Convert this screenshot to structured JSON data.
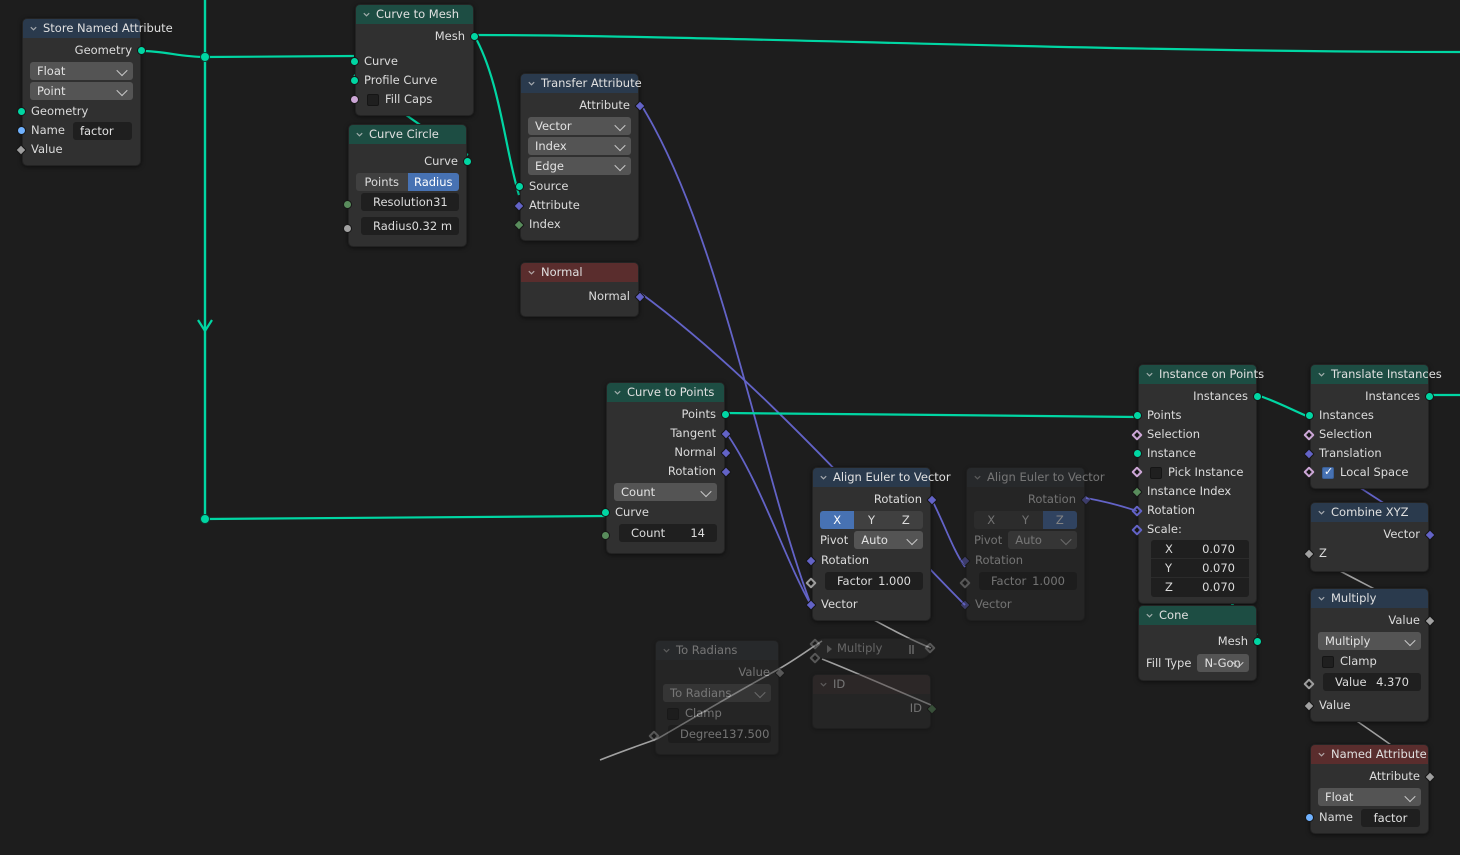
{
  "editor": {
    "name": "Geometry Node Editor",
    "background": "#1d1d1d"
  },
  "colors": {
    "header_geometry": "#1d4d43",
    "header_input": "#2a3a4d",
    "header_attribute": "#5a2d2d",
    "wire_geometry": "#00d6a3",
    "wire_vector": "#6363c7",
    "wire_value": "#a1a1a1",
    "accent_selected": "#4772b3"
  },
  "nodes": {
    "store_named_attribute": {
      "title": "Store Named Attribute",
      "data_type": "Float",
      "domain": "Point",
      "outputs": [
        {
          "label": "Geometry"
        }
      ],
      "inputs": [
        {
          "label": "Geometry"
        },
        {
          "label": "Name",
          "value": "factor"
        },
        {
          "label": "Value"
        }
      ]
    },
    "curve_to_mesh": {
      "title": "Curve to Mesh",
      "outputs": [
        {
          "label": "Mesh"
        }
      ],
      "inputs": [
        {
          "label": "Curve"
        },
        {
          "label": "Profile Curve"
        },
        {
          "label": "Fill Caps",
          "checked": false
        }
      ]
    },
    "curve_circle": {
      "title": "Curve Circle",
      "outputs": [
        {
          "label": "Curve"
        }
      ],
      "mode_options": [
        "Points",
        "Radius"
      ],
      "mode_selected": "Radius",
      "fields": [
        {
          "label": "Resolution",
          "value": "31"
        },
        {
          "label": "Radius",
          "value": "0.32 m"
        }
      ]
    },
    "transfer_attribute": {
      "title": "Transfer Attribute",
      "outputs": [
        {
          "label": "Attribute"
        }
      ],
      "data_type": "Vector",
      "mapping": "Index",
      "domain": "Edge",
      "inputs": [
        {
          "label": "Source"
        },
        {
          "label": "Attribute"
        },
        {
          "label": "Index"
        }
      ]
    },
    "normal": {
      "title": "Normal",
      "outputs": [
        {
          "label": "Normal"
        }
      ]
    },
    "curve_to_points": {
      "title": "Curve to Points",
      "outputs": [
        {
          "label": "Points"
        },
        {
          "label": "Tangent"
        },
        {
          "label": "Normal"
        },
        {
          "label": "Rotation"
        }
      ],
      "mode": "Count",
      "inputs": [
        {
          "label": "Curve"
        }
      ],
      "fields": [
        {
          "label": "Count",
          "value": "14"
        }
      ]
    },
    "align_euler_1": {
      "title": "Align Euler to Vector",
      "muted": false,
      "outputs": [
        {
          "label": "Rotation"
        }
      ],
      "axis_options": [
        "X",
        "Y",
        "Z"
      ],
      "axis_selected": "X",
      "pivot_label": "Pivot",
      "pivot_value": "Auto",
      "inputs": [
        {
          "label": "Rotation"
        },
        {
          "label": "Factor",
          "value": "1.000"
        },
        {
          "label": "Vector"
        }
      ]
    },
    "align_euler_2": {
      "title": "Align Euler to Vector",
      "muted": true,
      "outputs": [
        {
          "label": "Rotation"
        }
      ],
      "axis_options": [
        "X",
        "Y",
        "Z"
      ],
      "axis_selected": "Z",
      "pivot_label": "Pivot",
      "pivot_value": "Auto",
      "inputs": [
        {
          "label": "Rotation"
        },
        {
          "label": "Factor",
          "value": "1.000"
        },
        {
          "label": "Vector"
        }
      ]
    },
    "instance_on_points": {
      "title": "Instance on Points",
      "outputs": [
        {
          "label": "Instances"
        }
      ],
      "inputs": [
        {
          "label": "Points"
        },
        {
          "label": "Selection"
        },
        {
          "label": "Instance"
        },
        {
          "label": "Pick Instance",
          "checked": false
        },
        {
          "label": "Instance Index"
        },
        {
          "label": "Rotation"
        },
        {
          "label": "Scale:"
        }
      ],
      "scale": [
        {
          "axis": "X",
          "value": "0.070"
        },
        {
          "axis": "Y",
          "value": "0.070"
        },
        {
          "axis": "Z",
          "value": "0.070"
        }
      ]
    },
    "cone": {
      "title": "Cone",
      "outputs": [
        {
          "label": "Mesh"
        }
      ],
      "fill_type_label": "Fill Type",
      "fill_type_value": "N-Gon"
    },
    "translate_instances": {
      "title": "Translate Instances",
      "outputs": [
        {
          "label": "Instances"
        }
      ],
      "inputs": [
        {
          "label": "Instances"
        },
        {
          "label": "Selection"
        },
        {
          "label": "Translation"
        },
        {
          "label": "Local Space",
          "checked": true
        }
      ]
    },
    "combine_xyz": {
      "title": "Combine XYZ",
      "outputs": [
        {
          "label": "Vector"
        }
      ],
      "inputs": [
        {
          "label": "Z"
        }
      ]
    },
    "multiply_math": {
      "title": "Multiply",
      "outputs": [
        {
          "label": "Value"
        }
      ],
      "operation": "Multiply",
      "clamp_label": "Clamp",
      "clamp_checked": false,
      "fields": [
        {
          "label": "Value",
          "value": "4.370"
        }
      ],
      "inputs": [
        {
          "label": "Value"
        }
      ]
    },
    "named_attribute": {
      "title": "Named Attribute",
      "outputs": [
        {
          "label": "Attribute"
        }
      ],
      "data_type": "Float",
      "inputs": [
        {
          "label": "Name",
          "value": "factor"
        }
      ]
    },
    "to_radians": {
      "title": "To Radians",
      "muted": true,
      "outputs": [
        {
          "label": "Value"
        }
      ],
      "operation": "To Radians",
      "clamp_label": "Clamp",
      "clamp_checked": false,
      "fields": [
        {
          "label": "Degree",
          "value": "137.500"
        }
      ]
    },
    "multiply_collapsed": {
      "title": "Multiply",
      "muted": true,
      "collapsed": true
    },
    "id_node": {
      "title": "ID",
      "outputs": [
        {
          "label": "ID"
        }
      ]
    }
  }
}
